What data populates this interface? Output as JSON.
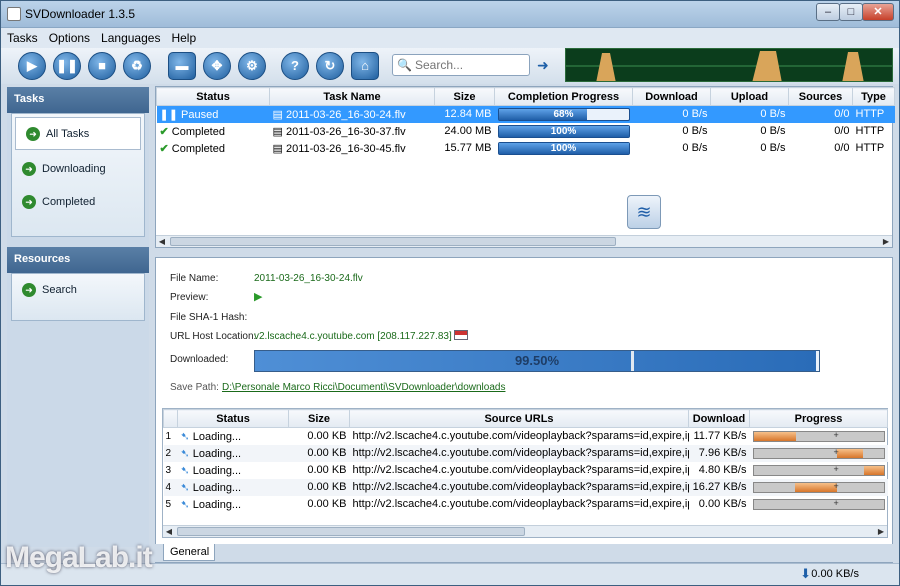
{
  "window": {
    "title": "SVDownloader 1.3.5"
  },
  "menu": [
    "Tasks",
    "Options",
    "Languages",
    "Help"
  ],
  "search": {
    "placeholder": "Search..."
  },
  "sidebar": {
    "tasks_header": "Tasks",
    "items": [
      {
        "label": "All Tasks"
      },
      {
        "label": "Downloading"
      },
      {
        "label": "Completed"
      }
    ],
    "resources_header": "Resources",
    "resources": [
      {
        "label": "Search"
      }
    ]
  },
  "tasks_table": {
    "columns": [
      "Status",
      "Task Name",
      "Size",
      "Completion Progress",
      "Download",
      "Upload",
      "Sources",
      "Type"
    ],
    "rows": [
      {
        "status": "Paused",
        "name": "2011-03-26_16-30-24.flv",
        "size": "12.84 MB",
        "progress": "68%",
        "progress_value": 0.68,
        "download": "0 B/s",
        "upload": "0 B/s",
        "sources": "0/0",
        "type": "HTTP"
      },
      {
        "status": "Completed",
        "name": "2011-03-26_16-30-37.flv",
        "size": "24.00 MB",
        "progress": "100%",
        "progress_value": 1.0,
        "download": "0 B/s",
        "upload": "0 B/s",
        "sources": "0/0",
        "type": "HTTP"
      },
      {
        "status": "Completed",
        "name": "2011-03-26_16-30-45.flv",
        "size": "15.77 MB",
        "progress": "100%",
        "progress_value": 1.0,
        "download": "0 B/s",
        "upload": "0 B/s",
        "sources": "0/0",
        "type": "HTTP"
      }
    ]
  },
  "details": {
    "file_name_label": "File Name:",
    "file_name": "2011-03-26_16-30-24.flv",
    "preview_label": "Preview:",
    "hash_label": "File SHA-1 Hash:",
    "url_label": "URL Host Location:",
    "url": "v2.lscache4.c.youtube.com [208.117.227.83]",
    "downloaded_label": "Downloaded:",
    "downloaded": "99.50%",
    "downloaded_value": 0.995,
    "save_path_label": "Save Path:",
    "save_path": "D:\\Personale Marco Ricci\\Documenti\\SVDownloader\\downloads"
  },
  "sources_table": {
    "columns": [
      "Status",
      "Size",
      "Source URLs",
      "Download",
      "Progress"
    ],
    "rows": [
      {
        "idx": "1",
        "status": "Loading...",
        "size": "0.00 KB",
        "url": "http://v2.lscache4.c.youtube.com/videoplayback?sparams=id,expire,ip,...",
        "download": "11.77 KB/s",
        "prog_start": 0.0,
        "prog_end": 0.33
      },
      {
        "idx": "2",
        "status": "Loading...",
        "size": "0.00 KB",
        "url": "http://v2.lscache4.c.youtube.com/videoplayback?sparams=id,expire,ip,...",
        "download": "7.96 KB/s",
        "prog_start": 0.64,
        "prog_end": 0.84
      },
      {
        "idx": "3",
        "status": "Loading...",
        "size": "0.00 KB",
        "url": "http://v2.lscache4.c.youtube.com/videoplayback?sparams=id,expire,ip,...",
        "download": "4.80 KB/s",
        "prog_start": 0.85,
        "prog_end": 1.0
      },
      {
        "idx": "4",
        "status": "Loading...",
        "size": "0.00 KB",
        "url": "http://v2.lscache4.c.youtube.com/videoplayback?sparams=id,expire,ip,...",
        "download": "16.27 KB/s",
        "prog_start": 0.32,
        "prog_end": 0.64
      },
      {
        "idx": "5",
        "status": "Loading...",
        "size": "0.00 KB",
        "url": "http://v2.lscache4.c.youtube.com/videoplayback?sparams=id,expire,ip,...",
        "download": "0.00 KB/s",
        "prog_start": 0.0,
        "prog_end": 0.0
      }
    ]
  },
  "tab": "General",
  "statusbar": {
    "speed": "0.00 KB/s"
  },
  "watermark": "MegaLab.it",
  "colors": {
    "accent": "#3399ff",
    "progress": "#1f5ea8",
    "source_progress": "#d7762a"
  }
}
